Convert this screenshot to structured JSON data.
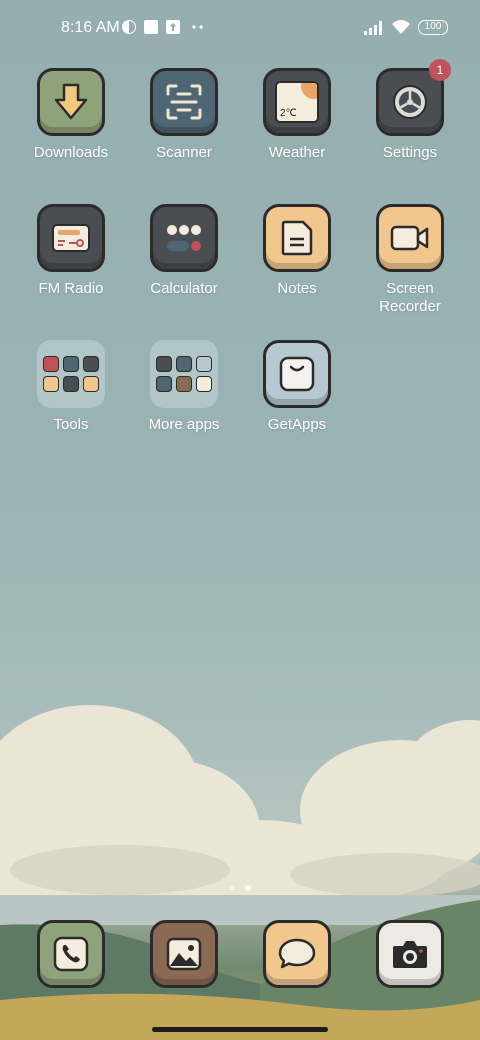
{
  "status": {
    "time": "8:16 AM",
    "battery": "100"
  },
  "apps": [
    {
      "label": "Downloads"
    },
    {
      "label": "Scanner"
    },
    {
      "label": "Weather",
      "temp": "2℃"
    },
    {
      "label": "Settings",
      "badge": "1"
    },
    {
      "label": "FM Radio"
    },
    {
      "label": "Calculator"
    },
    {
      "label": "Notes"
    },
    {
      "label": "Screen Recorder"
    },
    {
      "label": "Tools"
    },
    {
      "label": "More apps"
    },
    {
      "label": "GetApps"
    }
  ],
  "dock": [
    {
      "name": "phone-icon"
    },
    {
      "name": "gallery-icon"
    },
    {
      "name": "messages-icon"
    },
    {
      "name": "camera-icon"
    }
  ],
  "colors": {
    "sky": "#9ab3b5",
    "tile_green": "#8ea37a",
    "tile_blue": "#4e6673",
    "tile_gray": "#4a4d52",
    "tile_orange": "#f2c78e",
    "tile_light": "#b6c9d0",
    "badge": "#c0525a"
  },
  "pager": {
    "count": 2,
    "active": 1
  }
}
